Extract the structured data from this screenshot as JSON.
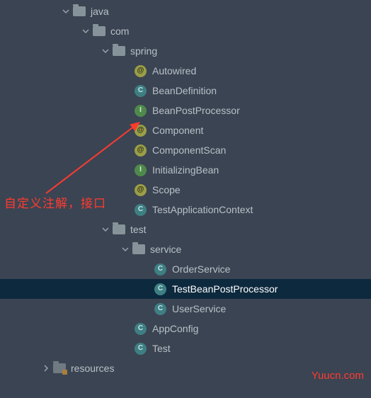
{
  "annotation": "自定义注解，接口",
  "watermark": "Yuucn.com",
  "tree": {
    "java": {
      "label": "java",
      "type": "folder",
      "expanded": true,
      "indent": 85
    },
    "com": {
      "label": "com",
      "type": "folder",
      "expanded": true,
      "indent": 113
    },
    "spring": {
      "label": "spring",
      "type": "folder",
      "expanded": true,
      "indent": 141
    },
    "autowired": {
      "label": "Autowired",
      "type": "annotation",
      "indent": 190
    },
    "beandef": {
      "label": "BeanDefinition",
      "type": "class",
      "indent": 190
    },
    "beanpp": {
      "label": "BeanPostProcessor",
      "type": "interface",
      "indent": 190
    },
    "component": {
      "label": "Component",
      "type": "annotation",
      "indent": 190
    },
    "compscan": {
      "label": "ComponentScan",
      "type": "annotation",
      "indent": 190
    },
    "initbean": {
      "label": "InitializingBean",
      "type": "interface",
      "indent": 190
    },
    "scope": {
      "label": "Scope",
      "type": "annotation",
      "indent": 190
    },
    "testappctx": {
      "label": "TestApplicationContext",
      "type": "class",
      "indent": 190
    },
    "test": {
      "label": "test",
      "type": "folder",
      "expanded": true,
      "indent": 141
    },
    "service": {
      "label": "service",
      "type": "folder",
      "expanded": true,
      "indent": 169
    },
    "ordersvc": {
      "label": "OrderService",
      "type": "class",
      "indent": 218
    },
    "testbpp": {
      "label": "TestBeanPostProcessor",
      "type": "class",
      "indent": 218,
      "selected": true
    },
    "usersvc": {
      "label": "UserService",
      "type": "class",
      "indent": 218
    },
    "appconfig": {
      "label": "AppConfig",
      "type": "class",
      "indent": 190
    },
    "testcls": {
      "label": "Test",
      "type": "class",
      "indent": 190
    },
    "resources": {
      "label": "resources",
      "type": "resfolder",
      "expanded": false,
      "indent": 57
    }
  }
}
